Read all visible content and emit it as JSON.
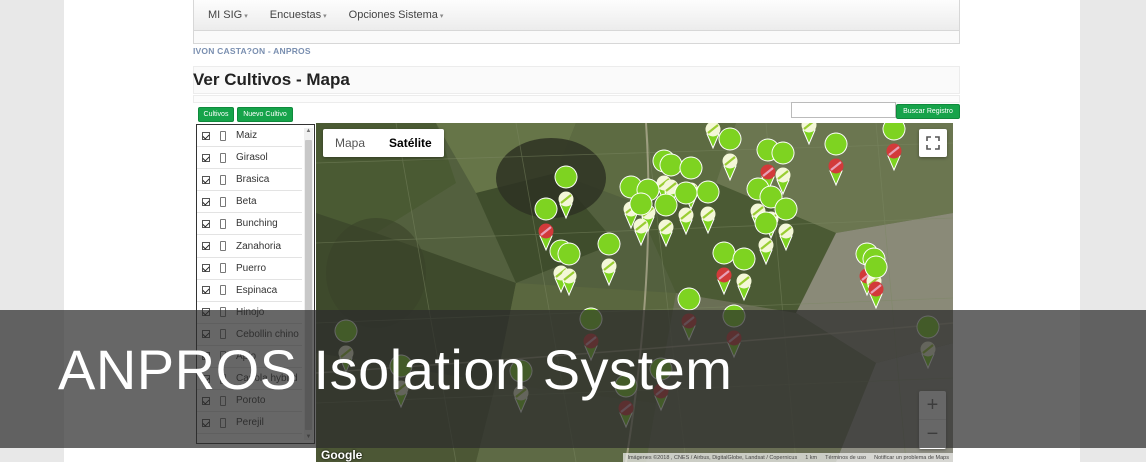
{
  "nav": {
    "items": [
      {
        "label": "MI SIG"
      },
      {
        "label": "Encuestas"
      },
      {
        "label": "Opciones Sistema"
      }
    ]
  },
  "user_line": "IVON CASTA?ON - ANPROS",
  "page_title": "Ver Cultivos - Mapa",
  "buttons": {
    "cultivos": "Cultivos",
    "nuevo_cultivo": "Nuevo Cultivo",
    "buscar_registro": "Buscar Registro"
  },
  "search": {
    "value": ""
  },
  "crops": [
    {
      "label": "Maiz"
    },
    {
      "label": "Girasol"
    },
    {
      "label": "Brasica"
    },
    {
      "label": "Beta"
    },
    {
      "label": "Bunching"
    },
    {
      "label": "Zanahoria"
    },
    {
      "label": "Puerro"
    },
    {
      "label": "Espinaca"
    },
    {
      "label": "Hinojo"
    },
    {
      "label": "Cebollin chino"
    },
    {
      "label": "Apio"
    },
    {
      "label": "Canola hybrid"
    },
    {
      "label": "Poroto"
    },
    {
      "label": "Perejil"
    }
  ],
  "map": {
    "tabs": [
      {
        "label": "Mapa",
        "active": false
      },
      {
        "label": "Satélite",
        "active": true
      }
    ],
    "zoom_in": "+",
    "zoom_out": "−",
    "logo": "Google",
    "attribution": [
      "Imágenes ©2018 , CNES / Airbus, DigitalGlobe, Landsat / Copernicus",
      "1 km",
      "Términos de uso",
      "Notificar un problema de Maps"
    ]
  },
  "colors": {
    "button_green": "#16a34a",
    "marker_green": "#7ed321",
    "marker_red": "#d23a3a",
    "marker_pink": "#e8a0b8"
  },
  "overlay": {
    "title": "ANPROS Isolation System"
  }
}
